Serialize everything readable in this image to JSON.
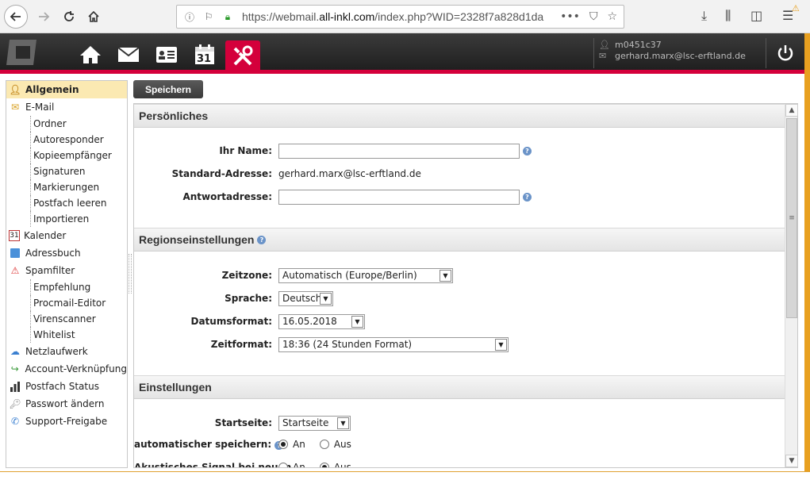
{
  "browser": {
    "url_prefix": "https://webmail.",
    "url_domain": "all-inkl.com",
    "url_rest": "/index.php?WID=2328f7a828d1da"
  },
  "header": {
    "user_id": "m0451c37",
    "user_email": "gerhard.marx@lsc-erftland.de",
    "calendar_day": "31"
  },
  "toolbar": {
    "save_label": "Speichern"
  },
  "sidebar": {
    "general": "Allgemein",
    "email": "E-Mail",
    "email_sub": [
      "Ordner",
      "Autoresponder",
      "Kopieempfänger",
      "Signaturen",
      "Markierungen",
      "Postfach leeren",
      "Importieren"
    ],
    "calendar": "Kalender",
    "addressbook": "Adressbuch",
    "spamfilter": "Spamfilter",
    "spam_sub": [
      "Empfehlung",
      "Procmail-Editor",
      "Virenscanner",
      "Whitelist"
    ],
    "netdrive": "Netzlaufwerk",
    "account_link": "Account-Verknüpfung",
    "mailbox_status": "Postfach Status",
    "change_password": "Passwort ändern",
    "support_share": "Support-Freigabe"
  },
  "personal": {
    "title": "Persönliches",
    "name_label": "Ihr Name:",
    "name_value": "",
    "std_address_label": "Standard-Adresse:",
    "std_address_value": "gerhard.marx@lsc-erftland.de",
    "reply_label": "Antwortadresse:",
    "reply_value": ""
  },
  "region": {
    "title": "Regionseinstellungen",
    "timezone_label": "Zeitzone:",
    "timezone_value": "Automatisch (Europe/Berlin)",
    "language_label": "Sprache:",
    "language_value": "Deutsch",
    "dateformat_label": "Datumsformat:",
    "dateformat_value": "16.05.2018",
    "timeformat_label": "Zeitformat:",
    "timeformat_value": "18:36 (24 Stunden Format)"
  },
  "settings": {
    "title": "Einstellungen",
    "startpage_label": "Startseite:",
    "startpage_value": "Startseite",
    "autosave_label": "automatischer speichern:",
    "opt_yes": "An",
    "opt_no": "Aus",
    "sound_label": "Akustisches Signal bei neuen"
  },
  "colors": {
    "accent": "#d4003b",
    "active_bg": "#fbe9b2"
  }
}
